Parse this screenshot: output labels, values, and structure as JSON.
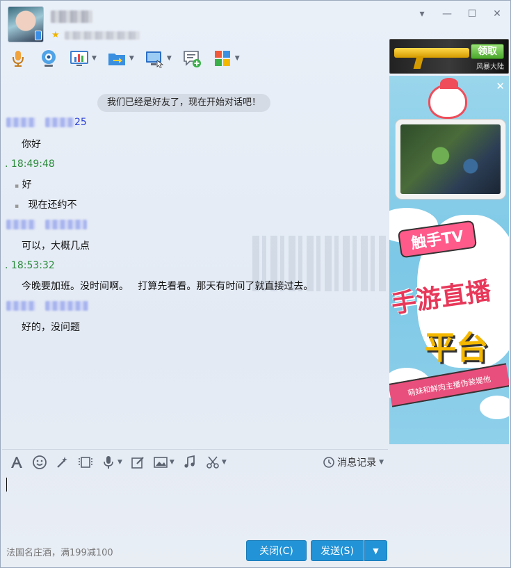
{
  "window": {
    "controls": {
      "dropdown": "▾",
      "minimize": "—",
      "maximize": "☐",
      "close": "✕"
    }
  },
  "header": {
    "contact_name_blurred": true,
    "toolbar": [
      {
        "name": "voice-call",
        "icon": "microphone-icon",
        "has_arrow": false
      },
      {
        "name": "video-call",
        "icon": "webcam-icon",
        "has_arrow": false
      },
      {
        "name": "remote-assist",
        "icon": "chart-screen-icon",
        "has_arrow": true
      },
      {
        "name": "send-file",
        "icon": "folder-arrow-icon",
        "has_arrow": true
      },
      {
        "name": "screen-share",
        "icon": "monitor-share-icon",
        "has_arrow": true
      },
      {
        "name": "new-chat",
        "icon": "chat-add-icon",
        "has_arrow": false
      },
      {
        "name": "apps",
        "icon": "apps-grid-icon",
        "has_arrow": true
      }
    ]
  },
  "banner_ad": {
    "cta": "领取",
    "sub": "风暴大陆"
  },
  "chat": {
    "system_message": "我们已经是好友了，现在开始对话吧！",
    "messages": [
      {
        "kind": "header-blue",
        "time_fragment": "25"
      },
      {
        "kind": "text",
        "text": "你好"
      },
      {
        "kind": "header-green",
        "time": "18:49:48"
      },
      {
        "kind": "text",
        "text": "好"
      },
      {
        "kind": "text",
        "text": "现在还约不"
      },
      {
        "kind": "header-blue",
        "time_fragment": ""
      },
      {
        "kind": "text",
        "text": "可以，大概几点"
      },
      {
        "kind": "header-green",
        "time": "18:53:32"
      },
      {
        "kind": "text",
        "text": "今晚要加班。没时间啊。   打算先看看。那天有时间了就直接过去。"
      },
      {
        "kind": "header-blue",
        "time_fragment": ""
      },
      {
        "kind": "text",
        "text": "好的，没问题"
      }
    ]
  },
  "input_toolbar": {
    "tools": [
      {
        "name": "font",
        "icon": "font-icon"
      },
      {
        "name": "emoji",
        "icon": "emoji-icon"
      },
      {
        "name": "nudge",
        "icon": "magic-wand-icon"
      },
      {
        "name": "gif",
        "icon": "film-icon"
      },
      {
        "name": "voice-message",
        "icon": "mic-icon"
      },
      {
        "name": "doodle",
        "icon": "edit-icon"
      },
      {
        "name": "image",
        "icon": "image-icon"
      },
      {
        "name": "music",
        "icon": "music-icon"
      },
      {
        "name": "screenshot",
        "icon": "scissors-icon"
      }
    ],
    "history_label": "消息记录"
  },
  "footer": {
    "promo_text": "法国名庄酒，满199减100",
    "close_label": "关闭(C)",
    "send_label": "发送(S)",
    "send_arrow": "▼"
  },
  "side_ad": {
    "brand": "触手TV",
    "headline_1": "手游直播",
    "headline_2": "平台",
    "ribbon": "萌妹和鲜肉主播伪装堤他"
  },
  "colors": {
    "primary_button": "#2293d7",
    "time_blue": "#2a3fd6",
    "time_green": "#2a8a3a",
    "system_bubble": "#d5dbe4"
  }
}
